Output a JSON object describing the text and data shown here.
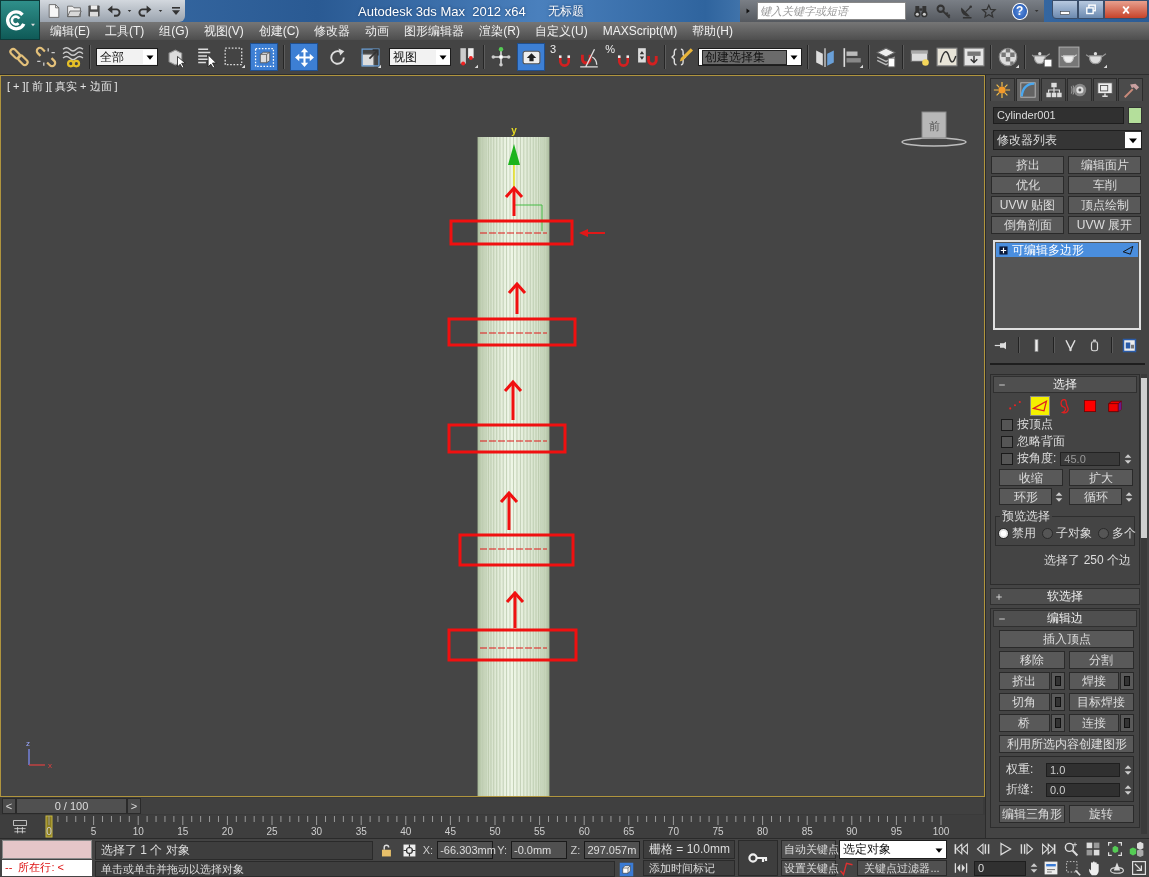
{
  "title_bar": {
    "title": "Autodesk 3ds Max  2012 x64",
    "document": "无标题",
    "search_placeholder": "键入关键字或短语",
    "help": "?"
  },
  "menu": [
    "编辑(E)",
    "工具(T)",
    "组(G)",
    "视图(V)",
    "创建(C)",
    "修改器",
    "动画",
    "图形编辑器",
    "渲染(R)",
    "自定义(U)",
    "MAXScript(M)",
    "帮助(H)"
  ],
  "toolbar": {
    "selection_filter": "全部",
    "select_object": {
      "selected": false
    },
    "window_crossing": {
      "selected": true
    },
    "move": {
      "selected": true
    },
    "rotate": {
      "selected": false
    },
    "scale": {
      "selected": false
    },
    "reference_coordinate": "视图",
    "shortcut_override": {
      "selected": true
    },
    "snap_label": "3",
    "percent_snap_label": "%",
    "named_selection": "创建选择集"
  },
  "viewport": {
    "label": "[ + ][ 前 ][ 真实 + 边面 ]",
    "active": true,
    "viewcube_label": "前",
    "gizmo_label": "y",
    "tripod_labels": [
      "z",
      "x"
    ]
  },
  "command_panel": {
    "tabs": [
      {
        "selected": false
      },
      {
        "selected": true
      },
      {
        "selected": false
      },
      {
        "selected": false
      },
      {
        "selected": false
      },
      {
        "selected": false
      }
    ],
    "object_name": "Cylinder001",
    "modifier_list": "修改器列表",
    "modifier_buttons": [
      "挤出",
      "编辑面片",
      "优化",
      "车削",
      "UVW 贴图",
      "顶点绘制",
      "倒角剖面",
      "UVW 展开"
    ],
    "stack": [
      {
        "label": "可编辑多边形",
        "selected": true
      }
    ],
    "selection": {
      "title": "选择",
      "expanded": true,
      "subobjects": [
        {
          "selected": false
        },
        {
          "selected": true
        },
        {
          "selected": false
        },
        {
          "selected": false
        },
        {
          "selected": false
        }
      ],
      "options": [
        {
          "label": "按顶点",
          "checked": false
        },
        {
          "label": "忽略背面",
          "checked": false
        },
        {
          "label": "按角度:",
          "checked": false,
          "value": "45.0"
        }
      ],
      "buttons": [
        {
          "label": "收缩",
          "spinner": false
        },
        {
          "label": "扩大",
          "spinner": false
        },
        {
          "label": "环形",
          "spinner": true
        },
        {
          "label": "循环",
          "spinner": true
        }
      ],
      "preview": {
        "title": "预览选择",
        "options": [
          {
            "label": "禁用",
            "selected": true
          },
          {
            "label": "子对象",
            "selected": false
          },
          {
            "label": "多个",
            "selected": false
          }
        ]
      },
      "summary": "选择了 250 个边"
    },
    "soft_selection": {
      "title": "软选择",
      "expanded": false
    },
    "edit_edges": {
      "title": "编辑边",
      "expanded": true,
      "rows": [
        [
          {
            "label": "插入顶点",
            "settings": false
          }
        ],
        [
          {
            "label": "移除",
            "settings": false
          },
          {
            "label": "分割",
            "settings": false
          }
        ],
        [
          {
            "label": "挤出",
            "settings": true
          },
          {
            "label": "焊接",
            "settings": true
          }
        ],
        [
          {
            "label": "切角",
            "settings": true
          },
          {
            "label": "目标焊接",
            "settings": false
          }
        ],
        [
          {
            "label": "桥",
            "settings": true
          },
          {
            "label": "连接",
            "settings": true
          }
        ],
        [
          {
            "label": "利用所选内容创建图形",
            "settings": false
          }
        ]
      ],
      "fields": [
        {
          "label": "权重:",
          "value": "1.0"
        },
        {
          "label": "折缝:",
          "value": "0.0"
        }
      ],
      "bottom_buttons": [
        "编辑三角形",
        "旋转"
      ]
    }
  },
  "timeline": {
    "previous": "<",
    "position": "0 / 100",
    "next": ">",
    "level": 0,
    "frame_labels": [
      "0",
      "5",
      "10",
      "15",
      "20",
      "25",
      "30",
      "35",
      "40",
      "45",
      "50",
      "55",
      "60",
      "65",
      "70",
      "75",
      "80",
      "85",
      "90",
      "95",
      "100"
    ]
  },
  "status": {
    "listener_line": "--  所在行: <",
    "selection": "选择了 1 个 对象",
    "prompt": "单击或单击并拖动以选择对象",
    "coordinates": [
      {
        "axis": "X:",
        "value": "-66.303mm"
      },
      {
        "axis": "Y:",
        "value": "-0.0mm"
      },
      {
        "axis": "Z:",
        "value": "297.057m"
      }
    ],
    "grid": "栅格 = 10.0mm",
    "time_tag": "添加时间标记",
    "auto_key": {
      "label": "自动关键点",
      "on": false
    },
    "set_key": "设置关键点",
    "key_set": "选定对象",
    "key_filters": "关键点过滤器...",
    "frame": "0"
  }
}
